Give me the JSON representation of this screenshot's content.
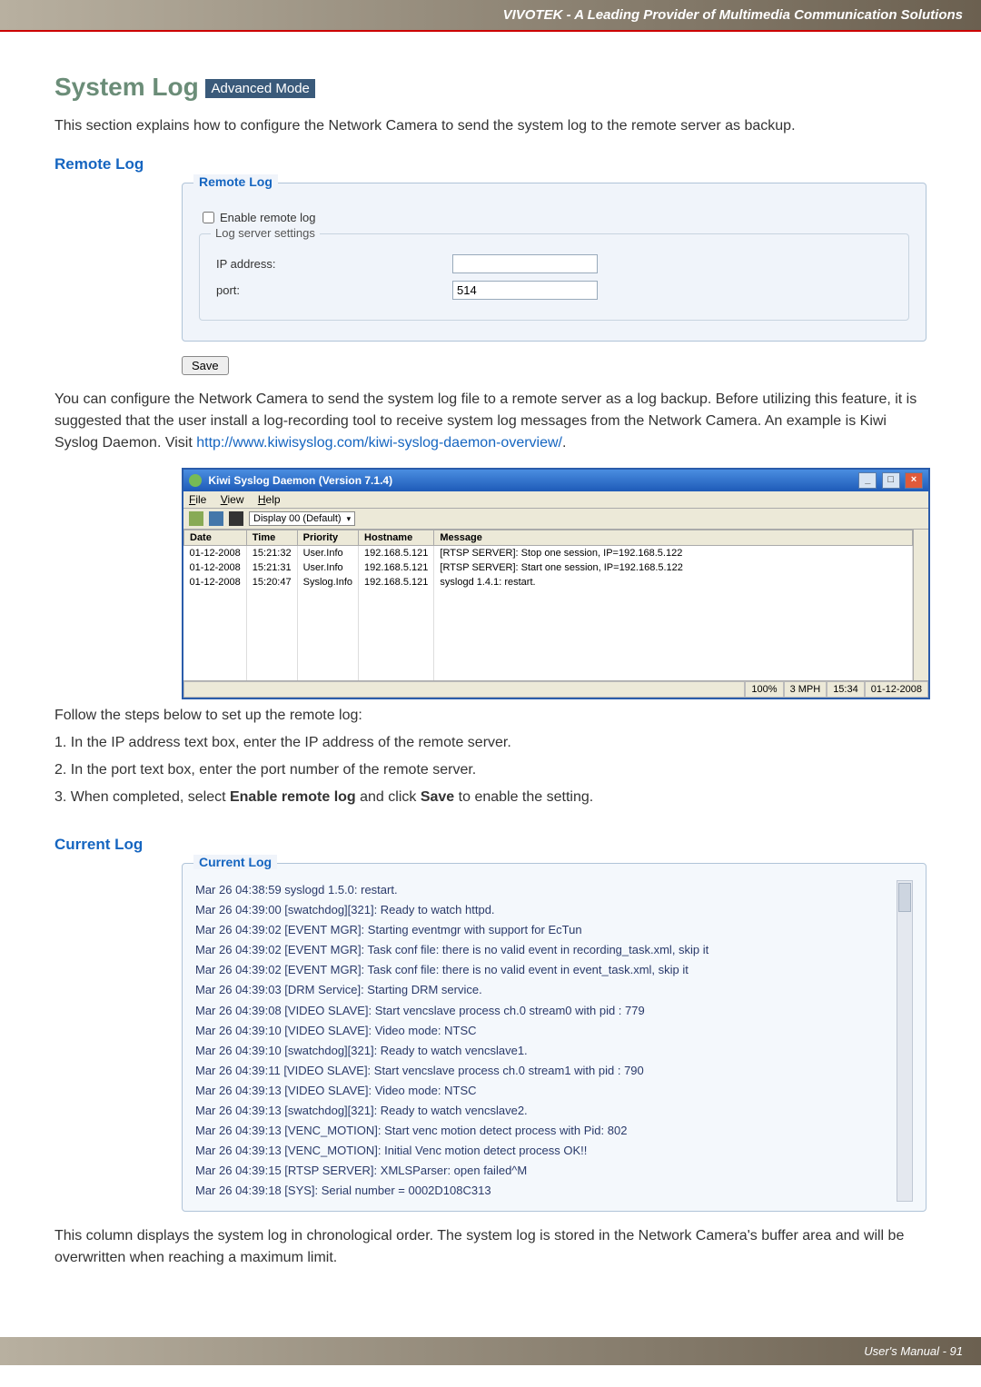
{
  "header_banner": "VIVOTEK - A Leading Provider of Multimedia Communication Solutions",
  "section_title": "System Log",
  "advanced_badge": "Advanced Mode",
  "intro": "This section explains how to configure the Network Camera to send the system log to the remote server as backup.",
  "remote_log": {
    "title": "Remote Log",
    "panel_legend": "Remote Log",
    "enable_label": "Enable remote log",
    "server_legend": "Log server settings",
    "ip_label": "IP address:",
    "ip_value": "",
    "port_label": "port:",
    "port_value": "514",
    "save_btn": "Save"
  },
  "para1": "You can configure the Network Camera to send the system log file to a remote server as a log backup. Before utilizing this feature, it is suggested that the user install a log-recording tool to receive system log messages from the Network Camera. An example is Kiwi Syslog Daemon. Visit ",
  "para1_link": "http://www.kiwisyslog.com/kiwi-syslog-daemon-overview/",
  "para1_end": ".",
  "kiwi": {
    "title": "Kiwi Syslog Daemon (Version 7.1.4)",
    "menu": [
      "File",
      "View",
      "Help"
    ],
    "display_dd": "Display 00 (Default)",
    "headers": [
      "Date",
      "Time",
      "Priority",
      "Hostname",
      "Message"
    ],
    "rows": [
      {
        "date": "01-12-2008",
        "time": "15:21:32",
        "prio": "User.Info",
        "host": "192.168.5.121",
        "msg": "[RTSP SERVER]: Stop one session, IP=192.168.5.122"
      },
      {
        "date": "01-12-2008",
        "time": "15:21:31",
        "prio": "User.Info",
        "host": "192.168.5.121",
        "msg": "[RTSP SERVER]: Start one session, IP=192.168.5.122"
      },
      {
        "date": "01-12-2008",
        "time": "15:20:47",
        "prio": "Syslog.Info",
        "host": "192.168.5.121",
        "msg": "syslogd 1.4.1: restart."
      }
    ],
    "status": {
      "pct": "100%",
      "mph": "3 MPH",
      "time": "15:34",
      "date": "01-12-2008"
    }
  },
  "steps_intro": "Follow the steps below to set up the remote log:",
  "steps": [
    "1. In the IP address text box, enter the IP address of the remote server.",
    "2. In the port text box, enter the port number of the remote server.",
    "3. When completed, select Enable remote log and click Save to enable the setting."
  ],
  "current_log": {
    "title": "Current Log",
    "panel_legend": "Current Log",
    "entries": [
      "Mar 26 04:38:59 syslogd 1.5.0: restart.",
      "Mar 26 04:39:00 [swatchdog][321]: Ready to watch httpd.",
      "Mar 26 04:39:02 [EVENT MGR]: Starting eventmgr with support for EcTun",
      "Mar 26 04:39:02 [EVENT MGR]: Task conf file: there is no valid event in recording_task.xml, skip it",
      "Mar 26 04:39:02 [EVENT MGR]: Task conf file: there is no valid event in event_task.xml, skip it",
      "Mar 26 04:39:03 [DRM Service]: Starting DRM service.",
      "Mar 26 04:39:08 [VIDEO SLAVE]: Start vencslave process ch.0 stream0 with pid : 779",
      "Mar 26 04:39:10 [VIDEO SLAVE]: Video mode: NTSC",
      "Mar 26 04:39:10 [swatchdog][321]: Ready to watch vencslave1.",
      "Mar 26 04:39:11 [VIDEO SLAVE]: Start vencslave process ch.0 stream1 with pid : 790",
      "Mar 26 04:39:13 [VIDEO SLAVE]: Video mode: NTSC",
      "Mar 26 04:39:13 [swatchdog][321]: Ready to watch vencslave2.",
      "Mar 26 04:39:13 [VENC_MOTION]: Start venc motion detect process with Pid: 802",
      "Mar 26 04:39:13 [VENC_MOTION]: Initial Venc motion detect process OK!!",
      "Mar 26 04:39:15 [RTSP SERVER]: XMLSParser: open failed^M",
      "Mar 26 04:39:18 [SYS]: Serial number = 0002D108C313"
    ]
  },
  "bottom_para": "This column displays the system log in chronological order. The system log is stored in the Network Camera's buffer area and will be overwritten when reaching a maximum limit.",
  "footer": "User's Manual - 91"
}
